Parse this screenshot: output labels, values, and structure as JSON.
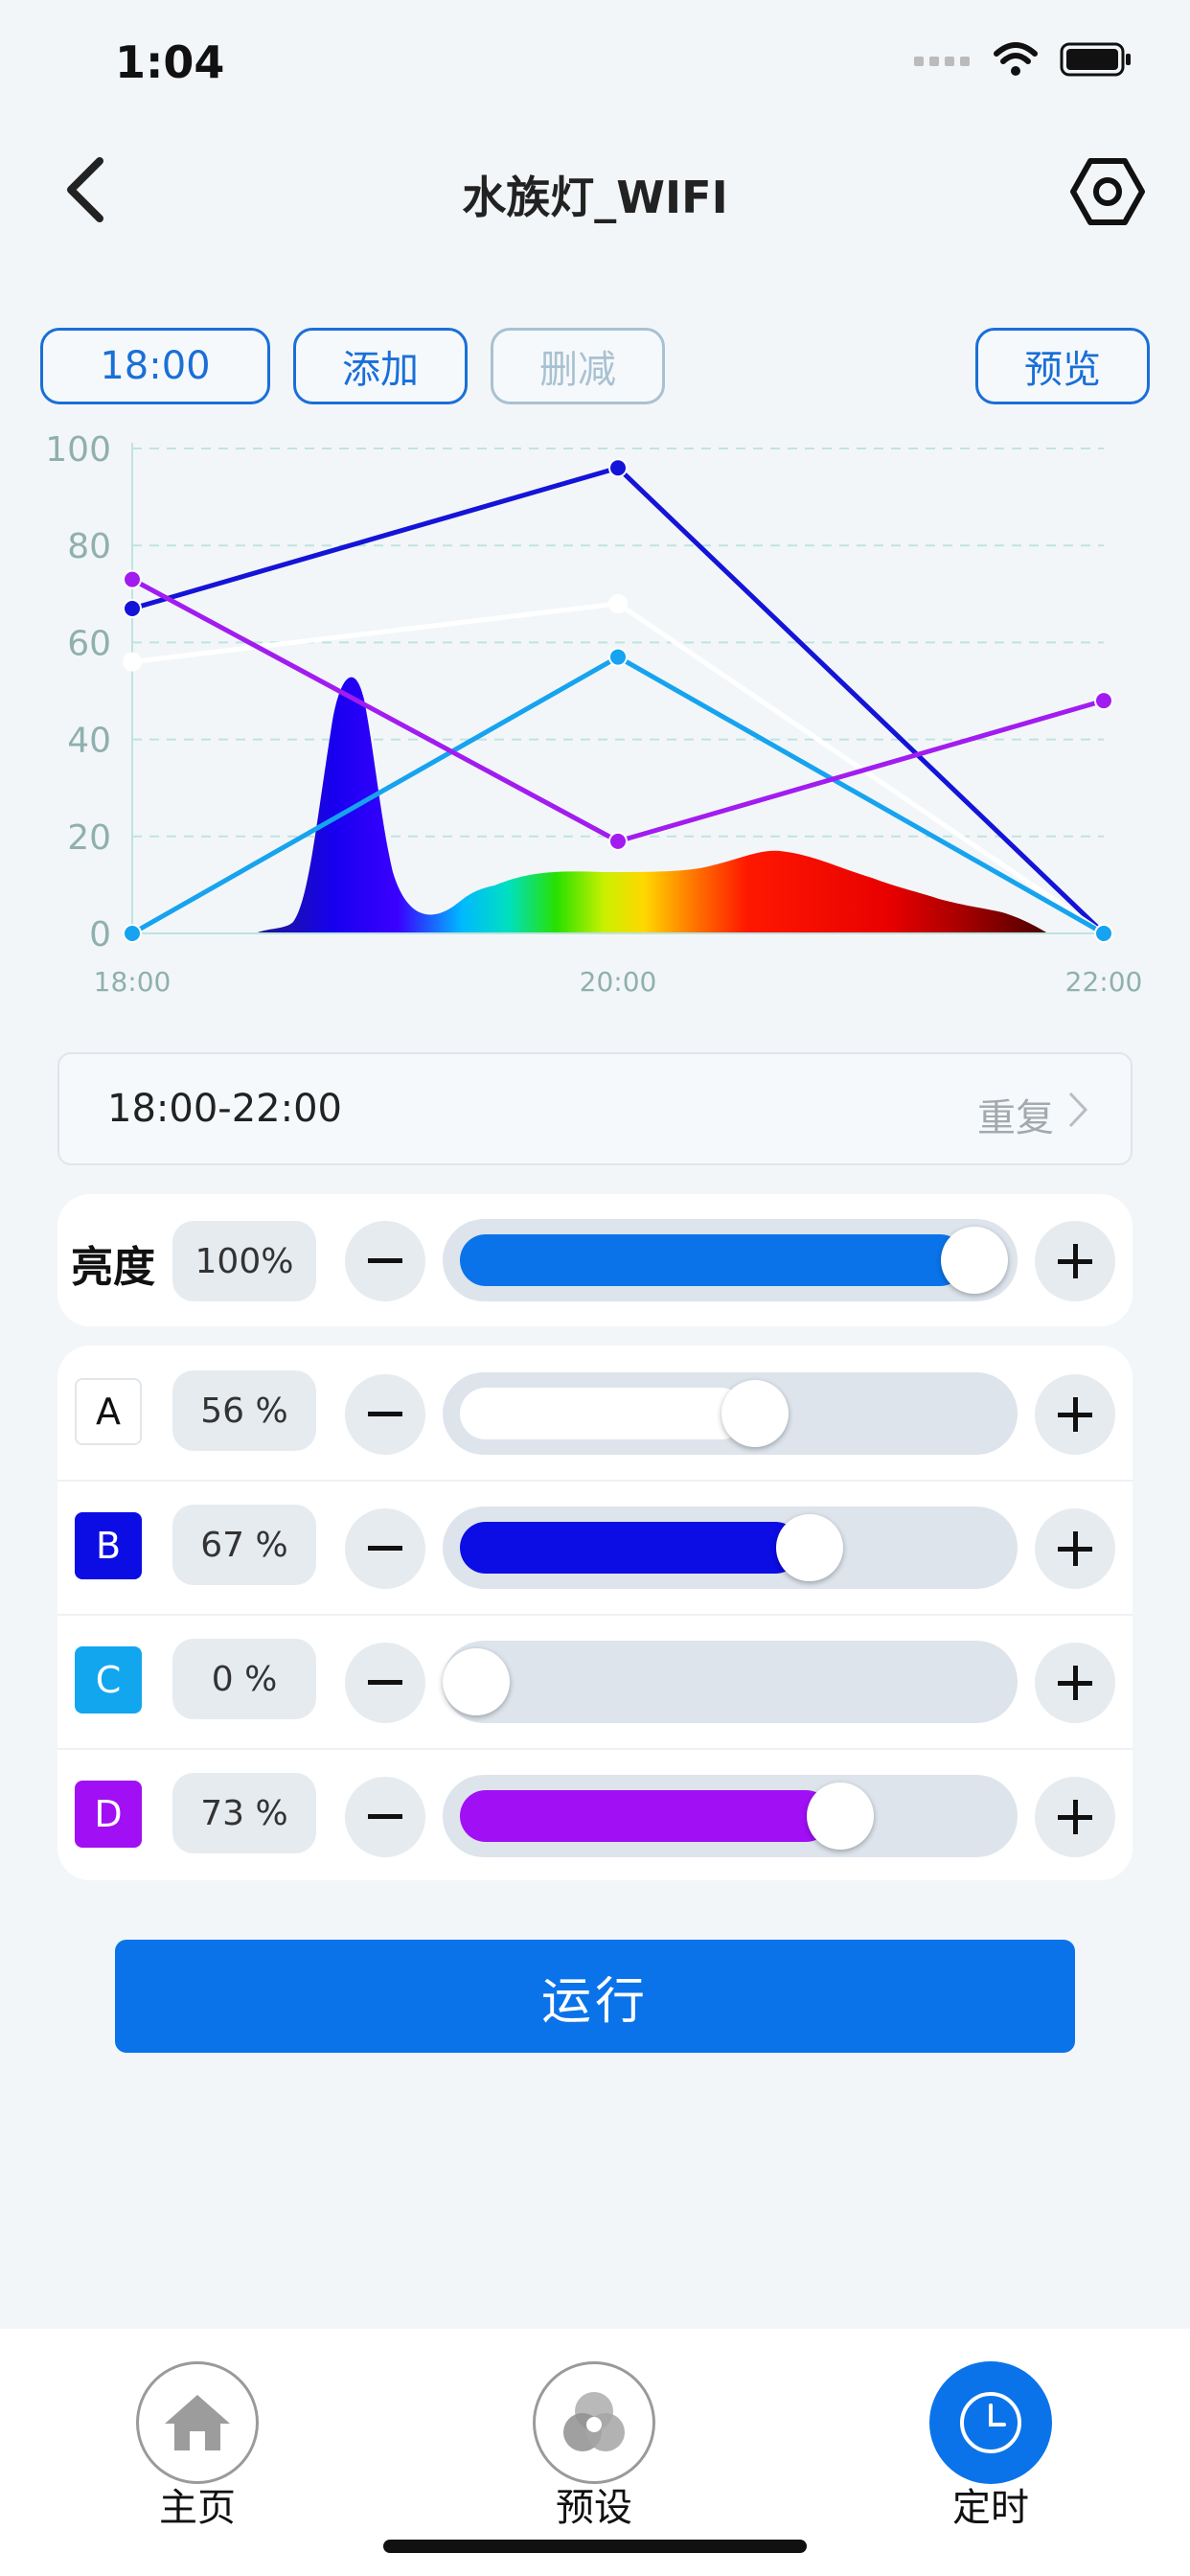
{
  "status_bar": {
    "time": "1:04"
  },
  "header": {
    "title": "水族灯_WIFI"
  },
  "toolbar": {
    "time_chip": "18:00",
    "add_label": "添加",
    "delete_label": "删减",
    "preview_label": "预览"
  },
  "chart_data": {
    "type": "line",
    "x": [
      "18:00",
      "20:00",
      "22:00"
    ],
    "ylim": [
      0,
      100
    ],
    "yticks": [
      0,
      20,
      40,
      60,
      80,
      100
    ],
    "series": [
      {
        "color": "#1414d8",
        "values": [
          67,
          96,
          0
        ]
      },
      {
        "color": "#ffffff",
        "values": [
          56,
          68,
          0
        ]
      },
      {
        "color": "#16a3ef",
        "values": [
          0,
          57,
          0
        ]
      },
      {
        "color": "#a21cf0",
        "values": [
          73,
          19,
          48
        ]
      }
    ],
    "grid": "horizontal-dashed"
  },
  "period": {
    "range": "18:00-22:00",
    "repeat_label": "重复"
  },
  "brightness": {
    "label": "亮度",
    "value_text": "100%",
    "value": 100,
    "color": "#0a73ea"
  },
  "channels": [
    {
      "label": "A",
      "value_text": "56 %",
      "value": 56,
      "color": "#ffffff"
    },
    {
      "label": "B",
      "value_text": "67 %",
      "value": 67,
      "color": "#0c0ce4"
    },
    {
      "label": "C",
      "value_text": "0  %",
      "value": 0,
      "color": "#12a6ef"
    },
    {
      "label": "D",
      "value_text": "73 %",
      "value": 73,
      "color": "#a10ff5"
    }
  ],
  "run_label": "运行",
  "tabs": [
    {
      "label": "主页",
      "icon": "home-icon",
      "active": false
    },
    {
      "label": "预设",
      "icon": "preset-icon",
      "active": false
    },
    {
      "label": "定时",
      "icon": "clock-icon",
      "active": true
    }
  ],
  "colors": {
    "accent": "#0a73ea",
    "chip": "#1a6fd8"
  }
}
